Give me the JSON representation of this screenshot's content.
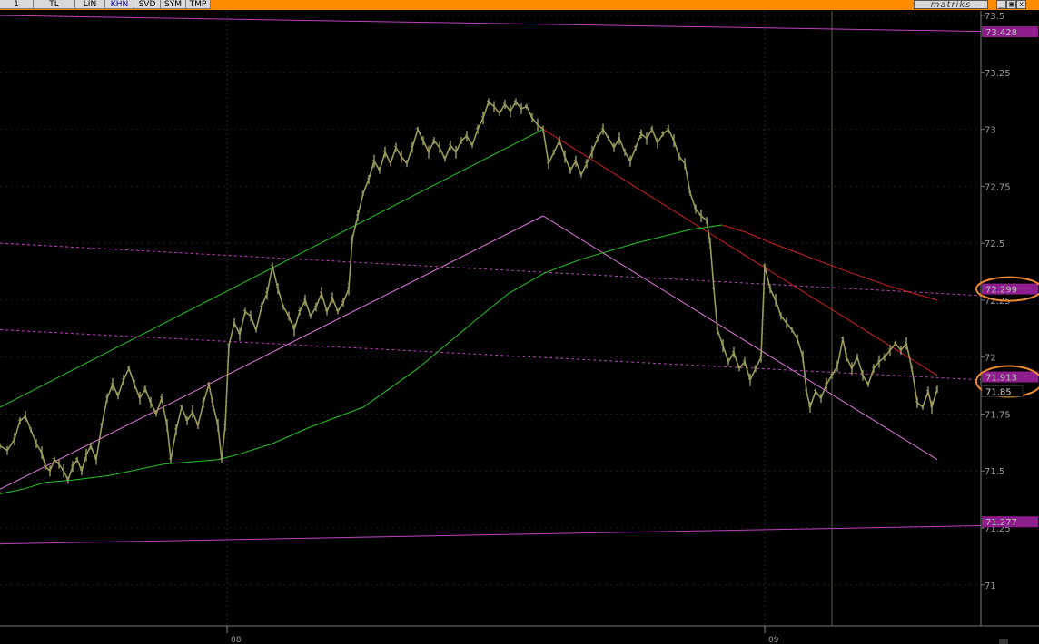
{
  "toolbar": {
    "buttons": [
      "1",
      "TL",
      "LIN",
      "KHN",
      "SVD",
      "SYM",
      "TMP"
    ],
    "active": "KHN",
    "brand": "matriks",
    "window_controls": [
      "_",
      "▣",
      "x"
    ]
  },
  "colors": {
    "background": "#000000",
    "toolbar": "#ff8c00",
    "price": "#9a9a5a",
    "green": "#22c322",
    "red": "#d42020",
    "magenta": "#c040c0",
    "pink": "#e07ae0",
    "marker_fill": "#8e1d8e",
    "highlight_ring": "#f08a30"
  },
  "chart_data": {
    "type": "line",
    "ylim": [
      70.82,
      73.52
    ],
    "y_ticks": [
      "73.5",
      "73.25",
      "73",
      "72.75",
      "72.5",
      "72.25",
      "72",
      "71.75",
      "71.5",
      "71",
      "71.25"
    ],
    "x_ticks": [
      "08",
      "09"
    ],
    "price_series": [
      [
        0,
        71.61
      ],
      [
        8,
        71.59
      ],
      [
        16,
        71.64
      ],
      [
        22,
        71.72
      ],
      [
        28,
        71.74
      ],
      [
        34,
        71.68
      ],
      [
        40,
        71.62
      ],
      [
        46,
        71.58
      ],
      [
        50,
        71.52
      ],
      [
        55,
        71.5
      ],
      [
        60,
        71.55
      ],
      [
        65,
        71.53
      ],
      [
        70,
        71.5
      ],
      [
        75,
        71.46
      ],
      [
        80,
        71.52
      ],
      [
        85,
        71.55
      ],
      [
        90,
        71.5
      ],
      [
        95,
        71.57
      ],
      [
        100,
        71.61
      ],
      [
        106,
        71.55
      ],
      [
        112,
        71.7
      ],
      [
        118,
        71.82
      ],
      [
        124,
        71.88
      ],
      [
        130,
        71.83
      ],
      [
        136,
        71.9
      ],
      [
        142,
        71.95
      ],
      [
        148,
        71.88
      ],
      [
        154,
        71.82
      ],
      [
        160,
        71.86
      ],
      [
        166,
        71.8
      ],
      [
        172,
        71.75
      ],
      [
        178,
        71.82
      ],
      [
        184,
        71.7
      ],
      [
        188,
        71.55
      ],
      [
        194,
        71.68
      ],
      [
        200,
        71.78
      ],
      [
        206,
        71.72
      ],
      [
        212,
        71.76
      ],
      [
        218,
        71.7
      ],
      [
        224,
        71.8
      ],
      [
        230,
        71.88
      ],
      [
        234,
        71.8
      ],
      [
        240,
        71.7
      ],
      [
        244,
        71.55
      ],
      [
        248,
        71.7
      ],
      [
        252,
        72.05
      ],
      [
        258,
        72.15
      ],
      [
        264,
        72.1
      ],
      [
        270,
        72.2
      ],
      [
        276,
        72.18
      ],
      [
        282,
        72.12
      ],
      [
        288,
        72.22
      ],
      [
        294,
        72.28
      ],
      [
        300,
        72.4
      ],
      [
        306,
        72.3
      ],
      [
        312,
        72.22
      ],
      [
        318,
        72.18
      ],
      [
        324,
        72.12
      ],
      [
        330,
        72.2
      ],
      [
        336,
        72.25
      ],
      [
        342,
        72.18
      ],
      [
        348,
        72.22
      ],
      [
        354,
        72.28
      ],
      [
        360,
        72.2
      ],
      [
        366,
        72.26
      ],
      [
        372,
        72.2
      ],
      [
        378,
        72.24
      ],
      [
        384,
        72.3
      ],
      [
        388,
        72.52
      ],
      [
        394,
        72.62
      ],
      [
        400,
        72.72
      ],
      [
        406,
        72.78
      ],
      [
        412,
        72.86
      ],
      [
        418,
        72.82
      ],
      [
        424,
        72.9
      ],
      [
        430,
        72.85
      ],
      [
        436,
        72.92
      ],
      [
        442,
        72.88
      ],
      [
        448,
        72.85
      ],
      [
        454,
        72.92
      ],
      [
        460,
        73.0
      ],
      [
        466,
        72.95
      ],
      [
        472,
        72.9
      ],
      [
        478,
        72.95
      ],
      [
        484,
        72.92
      ],
      [
        490,
        72.87
      ],
      [
        496,
        72.93
      ],
      [
        502,
        72.9
      ],
      [
        508,
        72.95
      ],
      [
        514,
        72.97
      ],
      [
        520,
        72.93
      ],
      [
        526,
        73.0
      ],
      [
        532,
        73.05
      ],
      [
        538,
        73.12
      ],
      [
        544,
        73.1
      ],
      [
        550,
        73.07
      ],
      [
        556,
        73.11
      ],
      [
        562,
        73.08
      ],
      [
        568,
        73.12
      ],
      [
        574,
        73.09
      ],
      [
        580,
        73.1
      ],
      [
        586,
        73.05
      ],
      [
        592,
        73.02
      ],
      [
        598,
        73.0
      ],
      [
        604,
        72.85
      ],
      [
        610,
        72.9
      ],
      [
        616,
        72.95
      ],
      [
        622,
        72.88
      ],
      [
        628,
        72.82
      ],
      [
        634,
        72.86
      ],
      [
        640,
        72.8
      ],
      [
        646,
        72.85
      ],
      [
        652,
        72.9
      ],
      [
        658,
        72.96
      ],
      [
        664,
        73.0
      ],
      [
        670,
        72.96
      ],
      [
        676,
        72.92
      ],
      [
        682,
        72.96
      ],
      [
        688,
        72.9
      ],
      [
        694,
        72.86
      ],
      [
        700,
        72.92
      ],
      [
        706,
        72.98
      ],
      [
        712,
        72.96
      ],
      [
        718,
        73.0
      ],
      [
        724,
        72.94
      ],
      [
        730,
        72.98
      ],
      [
        736,
        73.0
      ],
      [
        742,
        72.95
      ],
      [
        748,
        72.88
      ],
      [
        754,
        72.85
      ],
      [
        760,
        72.72
      ],
      [
        766,
        72.65
      ],
      [
        772,
        72.62
      ],
      [
        778,
        72.6
      ],
      [
        782,
        72.5
      ],
      [
        786,
        72.3
      ],
      [
        790,
        72.12
      ],
      [
        796,
        72.05
      ],
      [
        802,
        71.98
      ],
      [
        808,
        72.02
      ],
      [
        814,
        71.95
      ],
      [
        820,
        71.98
      ],
      [
        826,
        71.9
      ],
      [
        832,
        71.95
      ],
      [
        838,
        72.0
      ],
      [
        842,
        72.4
      ],
      [
        848,
        72.3
      ],
      [
        854,
        72.25
      ],
      [
        860,
        72.18
      ],
      [
        866,
        72.15
      ],
      [
        872,
        72.12
      ],
      [
        878,
        72.08
      ],
      [
        884,
        72.0
      ],
      [
        888,
        71.85
      ],
      [
        892,
        71.78
      ],
      [
        898,
        71.85
      ],
      [
        904,
        71.82
      ],
      [
        910,
        71.88
      ],
      [
        916,
        71.92
      ],
      [
        922,
        71.96
      ],
      [
        928,
        72.08
      ],
      [
        932,
        72.0
      ],
      [
        938,
        71.95
      ],
      [
        944,
        72.0
      ],
      [
        950,
        71.92
      ],
      [
        956,
        71.88
      ],
      [
        962,
        71.95
      ],
      [
        968,
        71.98
      ],
      [
        974,
        72.0
      ],
      [
        980,
        72.03
      ],
      [
        986,
        72.06
      ],
      [
        992,
        72.03
      ],
      [
        998,
        72.06
      ],
      [
        1004,
        71.95
      ],
      [
        1010,
        71.8
      ],
      [
        1016,
        71.78
      ],
      [
        1022,
        71.85
      ],
      [
        1026,
        71.78
      ],
      [
        1032,
        71.86
      ]
    ],
    "green_moving_avg": [
      [
        0,
        71.4
      ],
      [
        25,
        71.42
      ],
      [
        50,
        71.45
      ],
      [
        80,
        71.46
      ],
      [
        120,
        71.48
      ],
      [
        180,
        71.53
      ],
      [
        240,
        71.55
      ],
      [
        260,
        71.57
      ],
      [
        300,
        71.62
      ],
      [
        340,
        71.69
      ],
      [
        400,
        71.78
      ],
      [
        460,
        71.95
      ],
      [
        520,
        72.15
      ],
      [
        560,
        72.28
      ],
      [
        600,
        72.37
      ],
      [
        640,
        72.43
      ],
      [
        700,
        72.5
      ],
      [
        760,
        72.56
      ],
      [
        795,
        72.58
      ]
    ],
    "red_moving_avg": [
      [
        795,
        72.58
      ],
      [
        820,
        72.55
      ],
      [
        850,
        72.5
      ],
      [
        890,
        72.44
      ],
      [
        930,
        72.38
      ],
      [
        980,
        72.31
      ],
      [
        1032,
        72.25
      ]
    ],
    "trend_lines": [
      {
        "color": "green",
        "points": [
          [
            0,
            71.78
          ],
          [
            598,
            73.0
          ]
        ]
      },
      {
        "color": "pink",
        "points": [
          [
            0,
            71.42
          ],
          [
            598,
            72.62
          ]
        ]
      },
      {
        "color": "pink",
        "points": [
          [
            598,
            72.62
          ],
          [
            1032,
            71.55
          ]
        ]
      },
      {
        "color": "red",
        "points": [
          [
            598,
            73.0
          ],
          [
            1032,
            71.92
          ]
        ]
      },
      {
        "color": "magenta",
        "points": [
          [
            0,
            73.5
          ],
          [
            1080,
            73.43
          ]
        ]
      },
      {
        "color": "magenta",
        "points": [
          [
            0,
            71.18
          ],
          [
            1080,
            71.26
          ]
        ]
      },
      {
        "color": "magenta_dotted",
        "points": [
          [
            0,
            72.5
          ],
          [
            1080,
            72.27
          ]
        ]
      },
      {
        "color": "magenta_dotted",
        "points": [
          [
            0,
            72.12
          ],
          [
            1080,
            71.9
          ]
        ]
      }
    ],
    "price_labels": [
      {
        "text": "73.428",
        "value": 73.428
      },
      {
        "text": "72.299",
        "value": 72.299,
        "highlight": true
      },
      {
        "text": "71.913",
        "value": 71.913,
        "highlight": true
      },
      {
        "text": "71.277",
        "value": 71.277
      }
    ],
    "last_price": {
      "text": "71.85",
      "value": 71.85
    },
    "vertical_marker": 916
  }
}
